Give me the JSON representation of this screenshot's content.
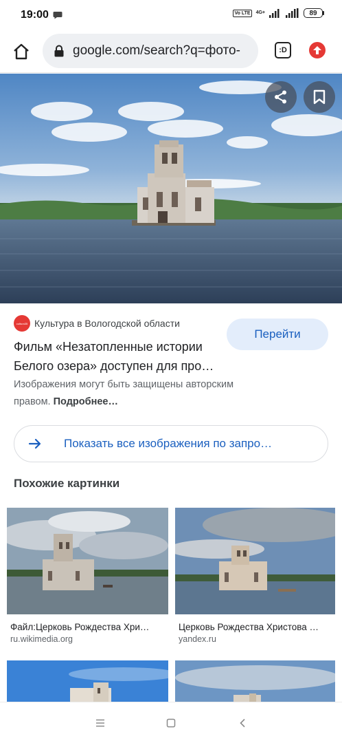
{
  "status_bar": {
    "time": "19:00",
    "network_type": "4G+",
    "volte": "Vo LTE",
    "battery": "89"
  },
  "toolbar": {
    "url": "google.com/search?q=фото-",
    "tab_label": ":D"
  },
  "hero": {
    "icons": [
      "share-icon",
      "bookmark-icon"
    ]
  },
  "result": {
    "source_favicon": "cultura35",
    "source_name": "Культура в Вологодской области",
    "title": "Фильм «Незатопленные истории Белого озера» доступен для про…",
    "visit_label": "Перейти",
    "copyright_text": "Изображения могут быть защищены авторским правом.",
    "more_link": "Подробнее…"
  },
  "show_all": {
    "label": "Показать все изображения по запро…"
  },
  "similar": {
    "heading": "Похожие картинки",
    "items": [
      {
        "title": "Файл:Церковь Рождества Хри…",
        "source": "ru.wikimedia.org"
      },
      {
        "title": "Церковь Рождества Христова …",
        "source": "yandex.ru"
      }
    ]
  },
  "colors": {
    "accent": "#1a5fbf",
    "visit_bg": "#e3edfb",
    "alert": "#e53935"
  }
}
